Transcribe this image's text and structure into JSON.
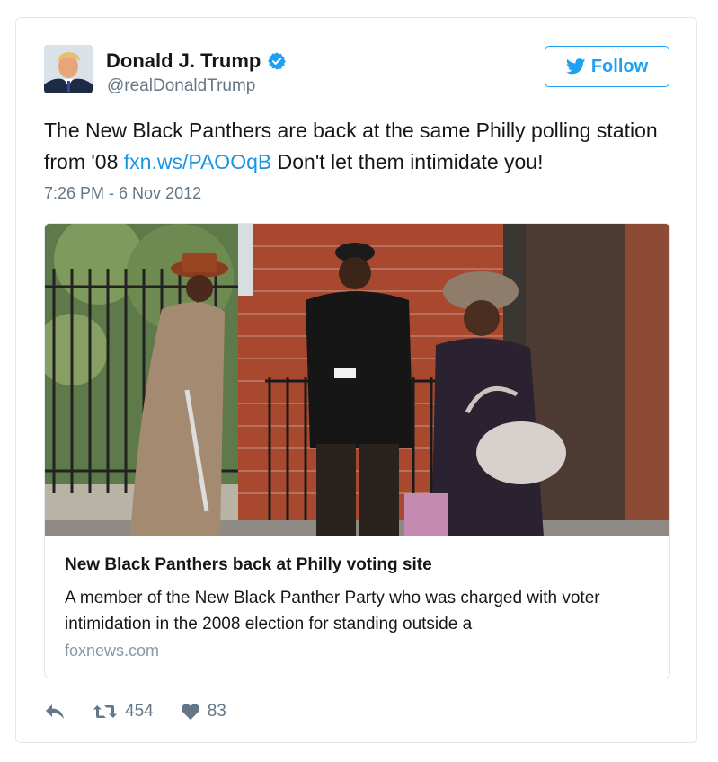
{
  "user": {
    "display_name": "Donald J. Trump",
    "handle": "@realDonaldTrump",
    "verified": true
  },
  "follow_button": {
    "label": "Follow"
  },
  "tweet": {
    "text_before": "The New Black Panthers are back at the same Philly polling station from '08 ",
    "link_text": "fxn.ws/PAOOqB",
    "text_after": " Don't let them intimidate you!",
    "timestamp": "7:26 PM - 6 Nov 2012"
  },
  "link_card": {
    "title": "New Black Panthers back at Philly voting site",
    "description": "A member of the New Black Panther Party who was charged with voter intimidation in the 2008 election for standing outside a",
    "domain": "foxnews.com"
  },
  "actions": {
    "reply_icon": "reply-icon",
    "retweet_count": "454",
    "like_count": "83"
  },
  "colors": {
    "accent": "#1da1f2",
    "link": "#1b95e0",
    "muted": "#657786",
    "border": "#e1e8ed"
  }
}
